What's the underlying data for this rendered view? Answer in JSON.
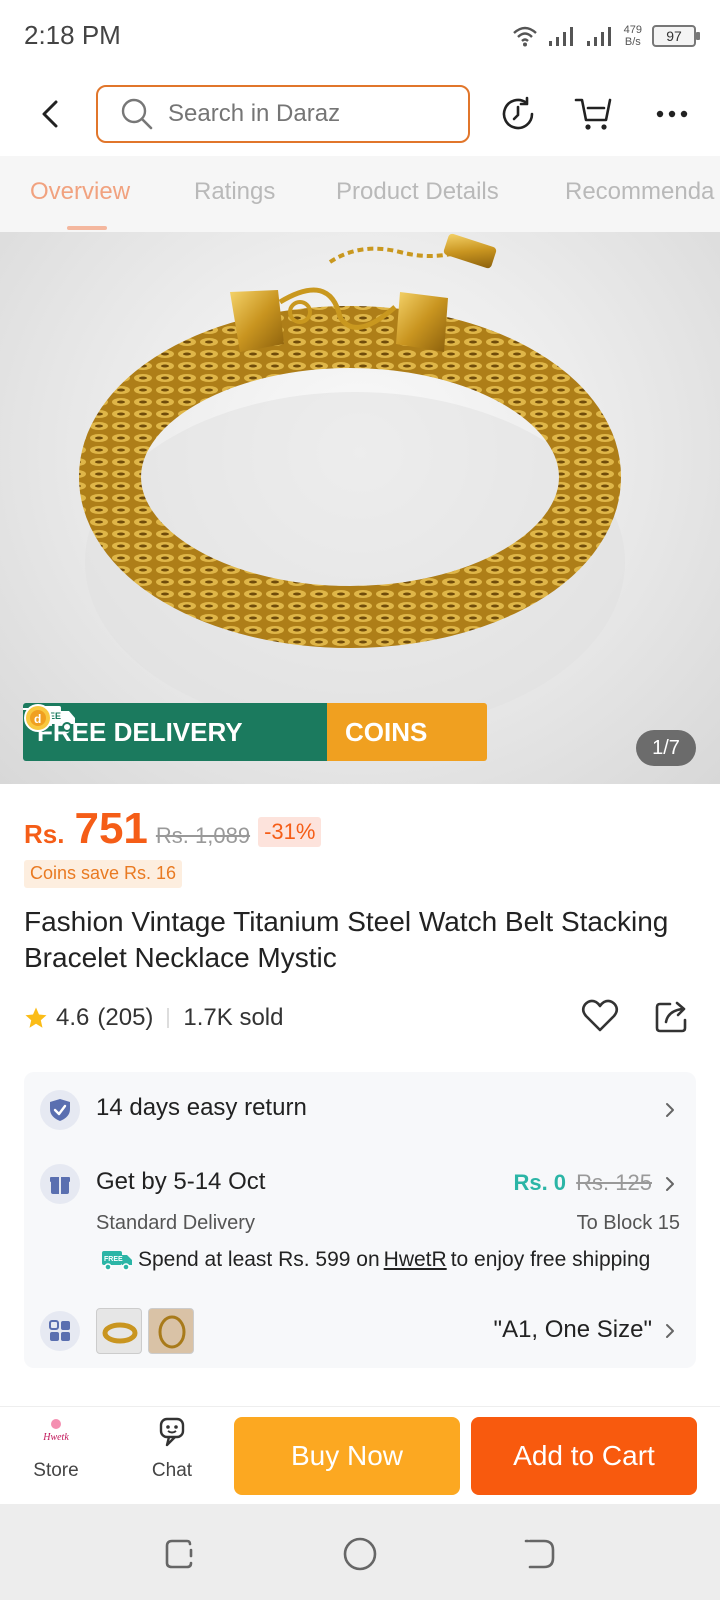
{
  "status_bar": {
    "time": "2:18 PM",
    "net_speed_value": "479",
    "net_speed_unit": "B/s",
    "battery": "97",
    "icons": [
      "wifi-icon",
      "signal-icon",
      "signal-icon",
      "battery-icon"
    ]
  },
  "header": {
    "back_icon": "back-arrow-icon",
    "search_placeholder": "Search in Daraz",
    "search_icon": "search-icon",
    "history_icon": "history-icon",
    "cart_icon": "cart-icon",
    "more_icon": "more-icon",
    "accent": "#e1762b"
  },
  "tabs": [
    {
      "label": "Overview",
      "active": true
    },
    {
      "label": "Ratings",
      "active": false
    },
    {
      "label": "Product Details",
      "active": false
    },
    {
      "label": "Recommenda",
      "active": false
    }
  ],
  "gallery": {
    "free_delivery_badge": "FREE",
    "free_delivery_label": "FREE DELIVERY",
    "coins_label": "COINS",
    "counter": "1/7",
    "image": "gold-mesh-bracelet"
  },
  "price": {
    "currency": "Rs.",
    "value": "751",
    "original": "Rs. 1,089",
    "discount": "-31%",
    "coins_save": "Coins save Rs. 16",
    "color": "#f55d17"
  },
  "product": {
    "title": "Fashion Vintage Titanium Steel Watch Belt Stacking Bracelet Necklace Mystic",
    "rating": "4.6",
    "reviews": "(205)",
    "sold": "1.7K sold"
  },
  "info": {
    "return_label": "14 days easy return",
    "delivery_label": "Get by 5-14 Oct",
    "delivery_type": "Standard Delivery",
    "ship_price": "Rs. 0",
    "ship_old_price": "Rs. 125",
    "to_location": "To Block 15",
    "free_ship_badge": "FREE",
    "free_ship_pre": "Spend at least Rs. 599 on",
    "free_ship_seller": "HwetR",
    "free_ship_post": "to enjoy free shipping",
    "variant": "\"A1, One Size\""
  },
  "bottom_bar": {
    "store_label": "Store",
    "store_logo_text": "Hwetk",
    "chat_label": "Chat",
    "buy_now": "Buy Now",
    "add_to_cart": "Add to Cart",
    "buy_color": "#fca821",
    "cart_color": "#f85a0e"
  },
  "system_nav": [
    "recent-apps-icon",
    "home-icon",
    "back-icon"
  ]
}
